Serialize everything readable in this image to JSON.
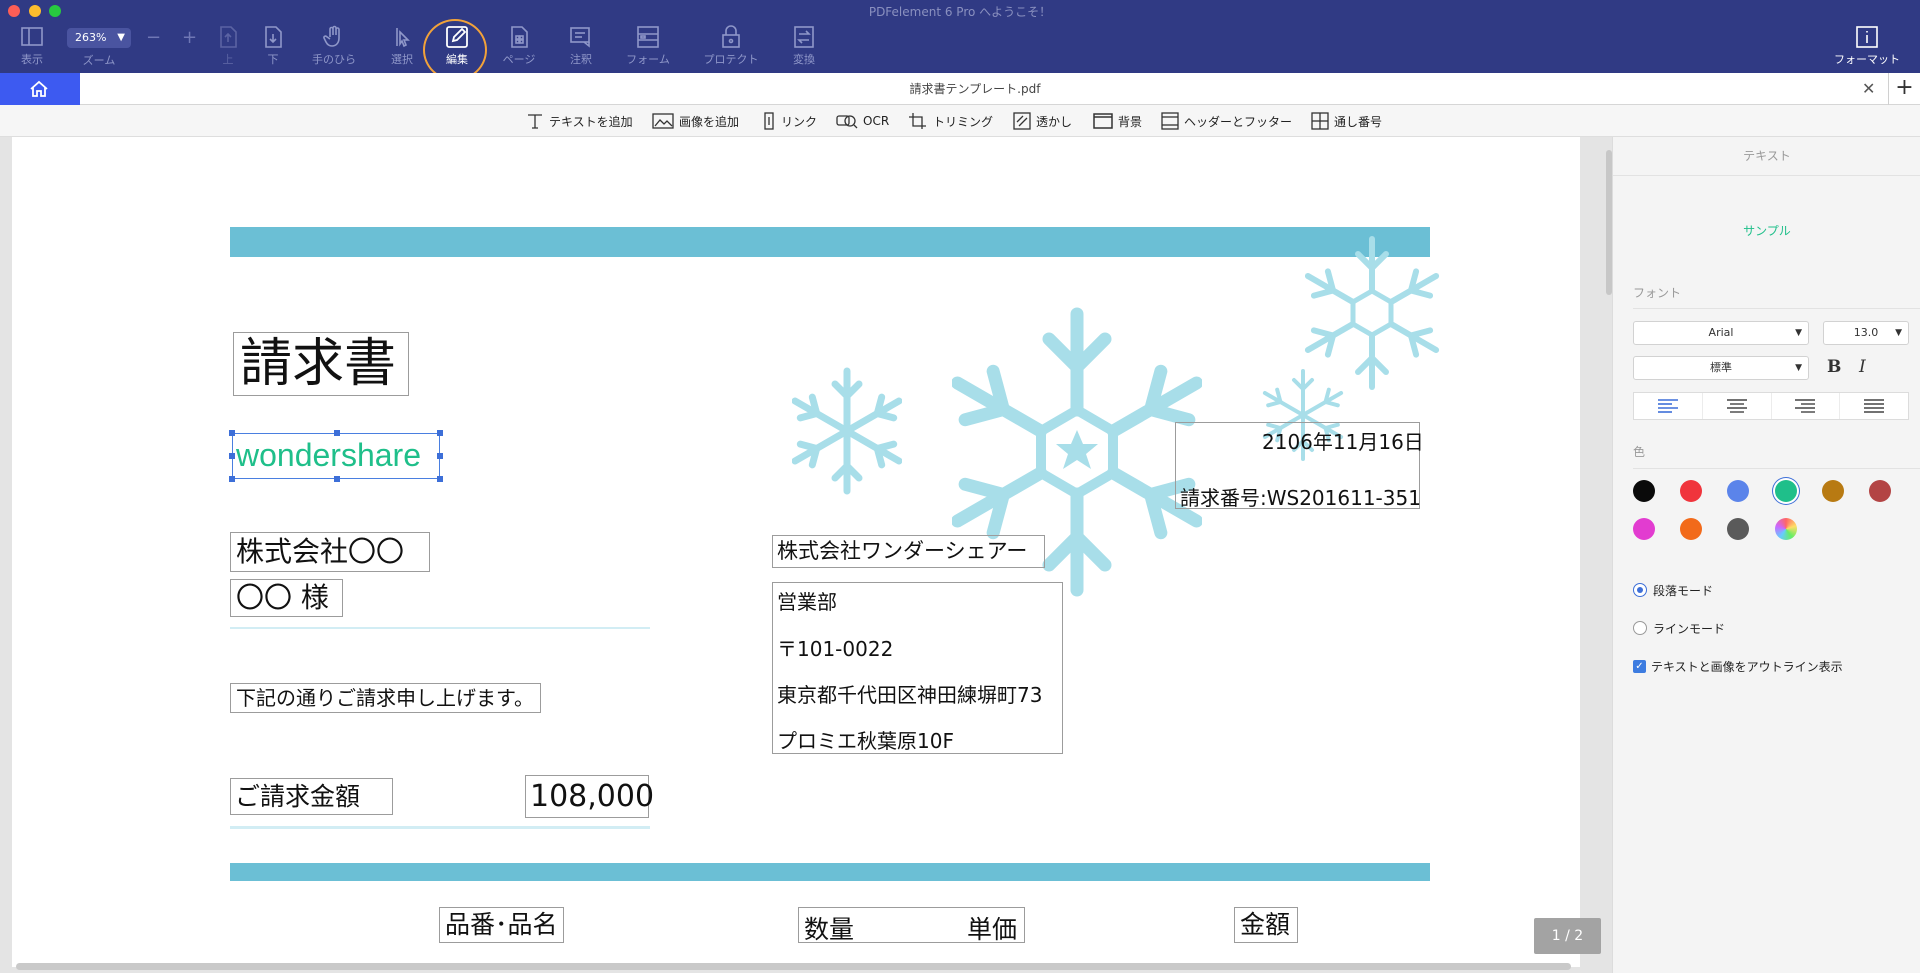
{
  "window": {
    "title": "PDFelement 6 Pro へようこそ！"
  },
  "toolbar": {
    "zoom_value": "263%",
    "zoom_label": "ズーム",
    "zoom_out": "−",
    "zoom_in": "+",
    "buttons": {
      "view": "表示",
      "up": "上",
      "down": "下",
      "hand": "手のひら",
      "select": "選択",
      "edit": "編集",
      "page": "ページ",
      "comment": "注釈",
      "form": "フォーム",
      "protect": "プロテクト",
      "convert": "変換",
      "format": "フォーマット"
    }
  },
  "tabs": {
    "document_title": "請求書テンプレート.pdf",
    "close": "✕",
    "add": "+"
  },
  "edit_toolbar": {
    "add_text": "テキストを追加",
    "add_image": "画像を追加",
    "link": "リンク",
    "ocr": "OCR",
    "crop": "トリミング",
    "watermark": "透かし",
    "background": "背景",
    "header_footer": "ヘッダーとフッター",
    "bates": "通し番号"
  },
  "document": {
    "title": "請求書",
    "company_logo_text": "wondershare",
    "client_company": "株式会社〇〇",
    "client_name": "〇〇 様",
    "date": "2106年11月16日",
    "invoice_number": "請求番号:WS201611-351",
    "sender_company": "株式会社ワンダーシェアー",
    "sender_department": "営業部",
    "sender_postal": "〒101-0022",
    "sender_address": "東京都千代田区神田練塀町73",
    "sender_building": "プロミエ秋葉原10F",
    "message": "下記の通りご請求申し上げます。",
    "amount_label": "ご請求金額",
    "amount_value": "108,000",
    "columns": {
      "item": "品番･品名",
      "quantity": "数量",
      "unit_price": "単価",
      "amount": "金額"
    },
    "page_indicator": "1 / 2",
    "colors": {
      "band": "#6bbfd5",
      "snowflake": "#a8dee9",
      "logo_text": "#1fbf8a"
    }
  },
  "panel": {
    "header": "テキスト",
    "sample": "サンプル",
    "font_section": "フォント",
    "font_family": "Arial",
    "font_size": "13.0",
    "font_style": "標準",
    "bold_label": "B",
    "italic_label": "I",
    "color_section": "色",
    "colors": [
      "#0a0a0a",
      "#f0343c",
      "#5b84ea",
      "#1fbf8a",
      "#b87a12",
      "#b34444",
      "#e23cd0",
      "#f26a1a",
      "#5a5a5a",
      "rainbow"
    ],
    "selected_color": "#1fbf8a",
    "paragraph_mode": "段落モード",
    "line_mode": "ラインモード",
    "outline_option": "テキストと画像をアウトライン表示"
  }
}
